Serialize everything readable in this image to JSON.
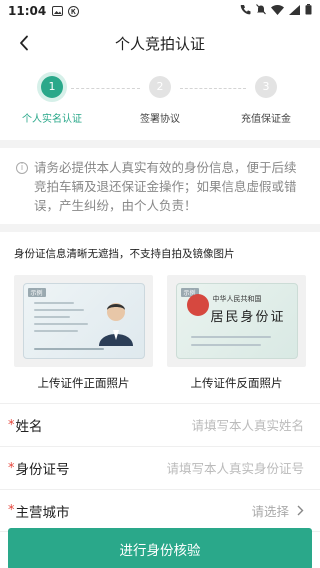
{
  "status_bar": {
    "time": "11:04"
  },
  "nav": {
    "title": "个人竞拍认证"
  },
  "steps": [
    {
      "num": "1",
      "label": "个人实名认证",
      "active": true
    },
    {
      "num": "2",
      "label": "签署协议",
      "active": false
    },
    {
      "num": "3",
      "label": "充值保证金",
      "active": false
    }
  ],
  "notice": {
    "text": "请务必提供本人真实有效的身份信息，便于后续竞拍车辆及退还保证金操作；如果信息虚假或错误，产生纠纷，由个人负责！"
  },
  "id_section": {
    "hint": "身份证信息清晰无遮挡，不支持自拍及镜像图片",
    "front_caption": "上传证件正面照片",
    "back_caption": "上传证件反面照片",
    "sample_tag": "示例",
    "back_title": "中华人民共和国",
    "back_heading": "居民身份证"
  },
  "form": {
    "name_label": "姓名",
    "name_placeholder": "请填写本人真实姓名",
    "id_label": "身份证号",
    "id_placeholder": "请填写本人真实身份证号",
    "city_label": "主营城市",
    "city_placeholder": "请选择",
    "required_mark": "*"
  },
  "submit_label": "进行身份核验",
  "colors": {
    "accent": "#2aa88a",
    "required": "#e5443a"
  }
}
